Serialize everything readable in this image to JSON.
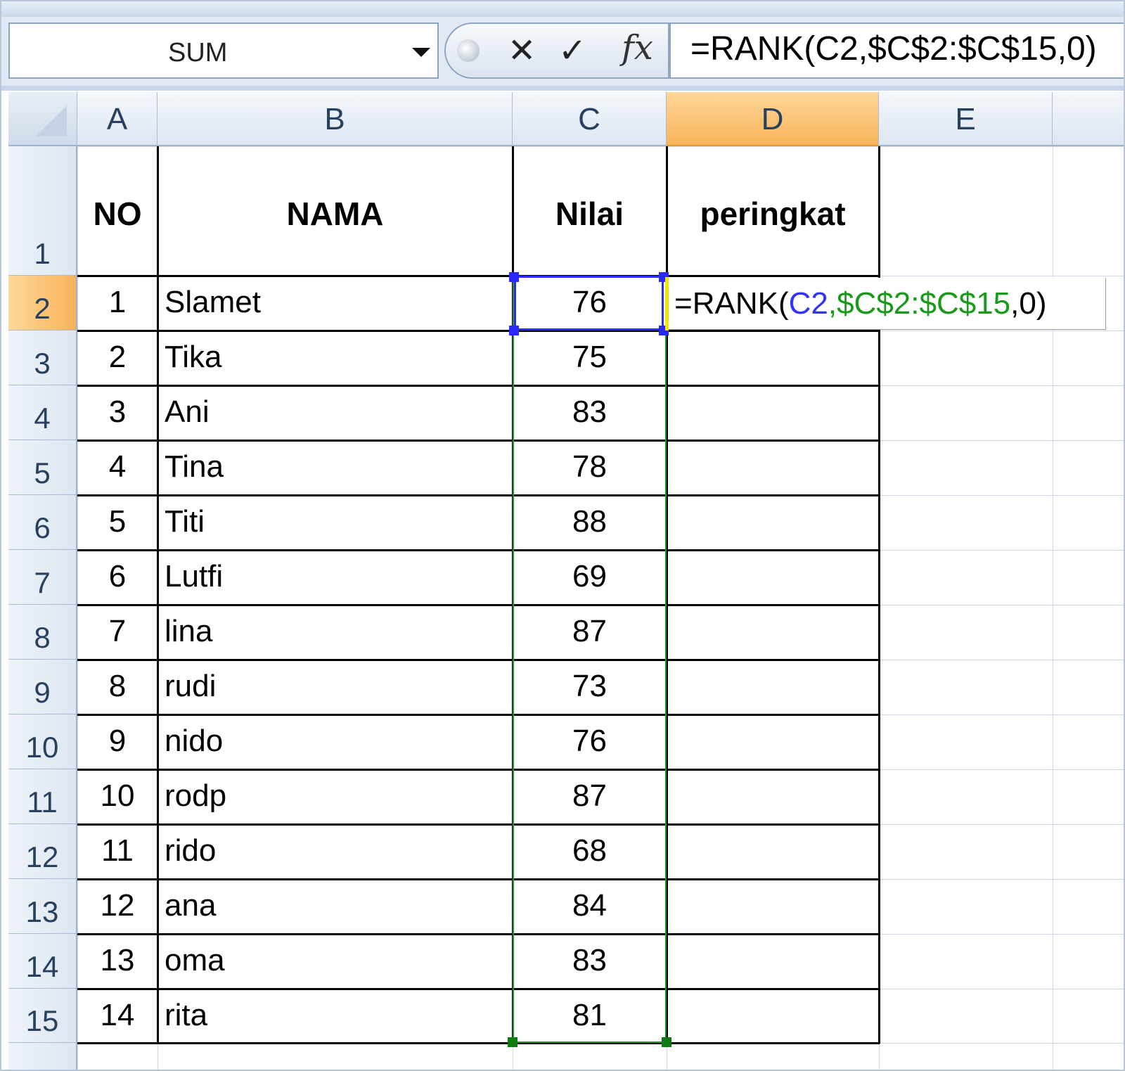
{
  "formula_bar": {
    "name_box": "SUM",
    "cancel_symbol": "✕",
    "enter_symbol": "✓",
    "fx_symbol": "fx",
    "formula": "=RANK(C2,$C$2:$C$15,0)"
  },
  "columns": [
    "A",
    "B",
    "C",
    "D",
    "E"
  ],
  "active_column": "D",
  "active_row": "2",
  "headers": {
    "no": "NO",
    "nama": "NAMA",
    "nilai": "Nilai",
    "peringkat": "peringkat"
  },
  "rows": [
    {
      "row": "2",
      "no": "1",
      "nama": "Slamet",
      "nilai": "76"
    },
    {
      "row": "3",
      "no": "2",
      "nama": "Tika",
      "nilai": "75"
    },
    {
      "row": "4",
      "no": "3",
      "nama": "Ani",
      "nilai": "83"
    },
    {
      "row": "5",
      "no": "4",
      "nama": "Tina",
      "nilai": "78"
    },
    {
      "row": "6",
      "no": "5",
      "nama": "Titi",
      "nilai": "88"
    },
    {
      "row": "7",
      "no": "6",
      "nama": "Lutfi",
      "nilai": "69"
    },
    {
      "row": "8",
      "no": "7",
      "nama": "lina",
      "nilai": "87"
    },
    {
      "row": "9",
      "no": "8",
      "nama": "rudi",
      "nilai": "73"
    },
    {
      "row": "10",
      "no": "9",
      "nama": "nido",
      "nilai": "76"
    },
    {
      "row": "11",
      "no": "10",
      "nama": "rodp",
      "nilai": "87"
    },
    {
      "row": "12",
      "no": "11",
      "nama": "rido",
      "nilai": "68"
    },
    {
      "row": "13",
      "no": "12",
      "nama": "ana",
      "nilai": "84"
    },
    {
      "row": "14",
      "no": "13",
      "nama": "oma",
      "nilai": "83"
    },
    {
      "row": "15",
      "no": "14",
      "nama": "rita",
      "nilai": "81"
    }
  ],
  "header_row": "1",
  "edit_cell": {
    "prefix": "=RANK(",
    "ref1": "C2",
    "sep": ",",
    "ref2": "$C$2:$C$15",
    "suffix": ",0)"
  },
  "colors": {
    "ref1": "#3333ff",
    "ref2": "#1a9a1a",
    "active_header": "#f7b35a",
    "selection_border": "#2a2aff"
  }
}
